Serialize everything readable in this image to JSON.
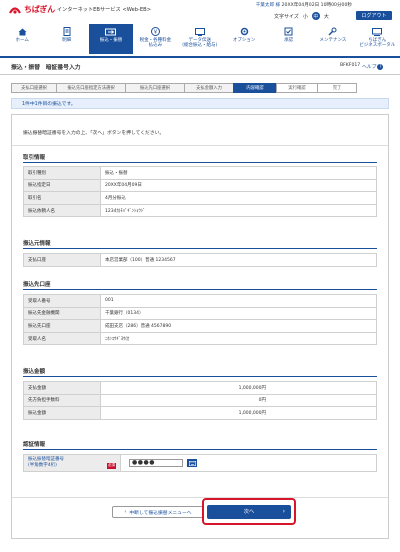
{
  "header": {
    "brand": "ちばぎん",
    "service": "インターネットEBサービス <Web-EB>",
    "user_name": "千葉太郎 様",
    "login_info": "20XX年04月02日 10時00分00秒",
    "font_size_label": "文字サイズ",
    "font_sizes": [
      "小",
      "中",
      "大"
    ],
    "logout_label": "ログアウト"
  },
  "nav": [
    {
      "label": "ホーム",
      "icon": "home-icon"
    },
    {
      "label": "明細",
      "icon": "document-icon"
    },
    {
      "label": "振込・振替",
      "icon": "transfer-icon",
      "active": true
    },
    {
      "label": "税金・各種料金\n払込み",
      "icon": "tax-icon"
    },
    {
      "label": "データ伝送\n(総合振込・給与)",
      "icon": "data-icon"
    },
    {
      "label": "オプション",
      "icon": "option-icon"
    },
    {
      "label": "承認",
      "icon": "approve-icon"
    },
    {
      "label": "メンテナンス",
      "icon": "maintenance-icon"
    },
    {
      "label": "ちばぎん\nビジネスポータル",
      "icon": "portal-icon"
    }
  ],
  "page": {
    "title": "振込・振替　暗証番号入力",
    "screen_id": "BFKF017",
    "help_label": "ヘルプ"
  },
  "steps": [
    {
      "label": "支払口座選択"
    },
    {
      "label": "振込先口座指定方法選択"
    },
    {
      "label": "振込先口座選択"
    },
    {
      "label": "支払金額入力"
    },
    {
      "label": "内容確認",
      "active": true
    },
    {
      "label": "実行確認"
    },
    {
      "label": "完了"
    }
  ],
  "progress_note": "1件中1件目の振込です。",
  "intro_text": "振込振替暗証番号を入力の上、「次へ」ボタンを押してください。",
  "sections": {
    "transaction": {
      "title": "取引情報",
      "rows": [
        {
          "k": "取引種別",
          "v": "振込・振替"
        },
        {
          "k": "振込指定日",
          "v": "20XX年04月09日"
        },
        {
          "k": "取引名",
          "v": "4月分振込"
        },
        {
          "k": "振込依頼人名",
          "v": "1234ｶ)ﾁﾊﾞｷﾞﾝｼｮｳｼﾞ"
        }
      ]
    },
    "source": {
      "title": "振込元情報",
      "rows": [
        {
          "k": "支払口座",
          "v": "本店営業部（100）普通 1234567"
        }
      ]
    },
    "destination": {
      "title": "振込先口座",
      "rows": [
        {
          "k": "受取人番号",
          "v": "001"
        },
        {
          "k": "振込先金融機関",
          "v": "千葉銀行（0134）"
        },
        {
          "k": "振込先口座",
          "v": "成田支店（286）普通 4567890"
        },
        {
          "k": "受取人名",
          "v": "ﾆﾎﾝｺｳｷﾞﾖｳ(ｶ"
        }
      ]
    },
    "amount": {
      "title": "振込金額",
      "rows": [
        {
          "k": "支払金額",
          "v": "1,000,000円"
        },
        {
          "k": "先方負担手数料",
          "v": "0円"
        },
        {
          "k": "振込金額",
          "v": "1,000,000円"
        }
      ]
    },
    "auth": {
      "title": "認証情報",
      "label": "振込振替暗証番号",
      "hint": "(半角数字4桁)",
      "required": "必須",
      "value": "●●●●"
    }
  },
  "buttons": {
    "back": "中断して振込振替メニューへ",
    "next": "次へ"
  },
  "colors": {
    "brand_red": "#d8152a",
    "primary_blue": "#1a4f9c"
  }
}
